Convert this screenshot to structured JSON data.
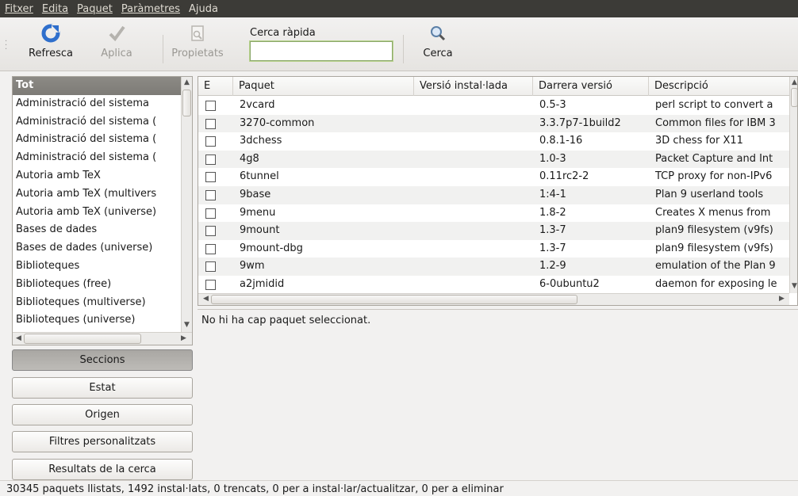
{
  "menubar": {
    "items": [
      "Fitxer",
      "Edita",
      "Paquet",
      "Paràmetres",
      "Ajuda"
    ]
  },
  "toolbar": {
    "reload_label": "Refresca",
    "apply_label": "Aplica",
    "properties_label": "Propietats",
    "quick_search_label": "Cerca ràpida",
    "quick_search_value": "",
    "search_label": "Cerca"
  },
  "sections": {
    "items": [
      "Tot",
      "Administració del sistema",
      "Administració del sistema (",
      "Administració del sistema (",
      "Administració del sistema (",
      "Autoria amb TeX",
      "Autoria amb TeX (multivers",
      "Autoria amb TeX (universe)",
      "Bases de dades",
      "Bases de dades (universe)",
      "Biblioteques",
      "Biblioteques (free)",
      "Biblioteques (multiverse)",
      "Biblioteques (universe)"
    ],
    "selected_index": 0
  },
  "filters": {
    "sections": "Seccions",
    "status": "Estat",
    "origin": "Origen",
    "custom": "Filtres personalitzats",
    "search_results": "Resultats de la cerca"
  },
  "packages": {
    "columns": [
      "E",
      "Paquet",
      "Versió instal·lada",
      "Darrera versió",
      "Descripció"
    ],
    "rows": [
      {
        "name": "2vcard",
        "installed": "",
        "latest": "0.5-3",
        "desc": "perl script to convert a"
      },
      {
        "name": "3270-common",
        "installed": "",
        "latest": "3.3.7p7-1build2",
        "desc": "Common files for IBM 3"
      },
      {
        "name": "3dchess",
        "installed": "",
        "latest": "0.8.1-16",
        "desc": "3D chess for X11"
      },
      {
        "name": "4g8",
        "installed": "",
        "latest": "1.0-3",
        "desc": "Packet Capture and Int"
      },
      {
        "name": "6tunnel",
        "installed": "",
        "latest": "0.11rc2-2",
        "desc": "TCP proxy for non-IPv6"
      },
      {
        "name": "9base",
        "installed": "",
        "latest": "1:4-1",
        "desc": "Plan 9 userland tools"
      },
      {
        "name": "9menu",
        "installed": "",
        "latest": "1.8-2",
        "desc": "Creates X menus from"
      },
      {
        "name": "9mount",
        "installed": "",
        "latest": "1.3-7",
        "desc": "plan9 filesystem (v9fs)"
      },
      {
        "name": "9mount-dbg",
        "installed": "",
        "latest": "1.3-7",
        "desc": "plan9 filesystem (v9fs)"
      },
      {
        "name": "9wm",
        "installed": "",
        "latest": "1.2-9",
        "desc": "emulation of the Plan 9"
      },
      {
        "name": "a2jmidid",
        "installed": "",
        "latest": "6-0ubuntu2",
        "desc": "daemon for exposing le"
      }
    ]
  },
  "details": {
    "message": "No hi ha cap paquet seleccionat."
  },
  "status": {
    "text": "30345 paquets llistats, 1492 instal·lats, 0 trencats, 0 per a instal·lar/actualitzar, 0 per a eliminar"
  },
  "colors": {
    "menubar_bg": "#3c3b37",
    "selection_bg": "#8c8a85",
    "reload_icon": "#2f6fcc"
  }
}
